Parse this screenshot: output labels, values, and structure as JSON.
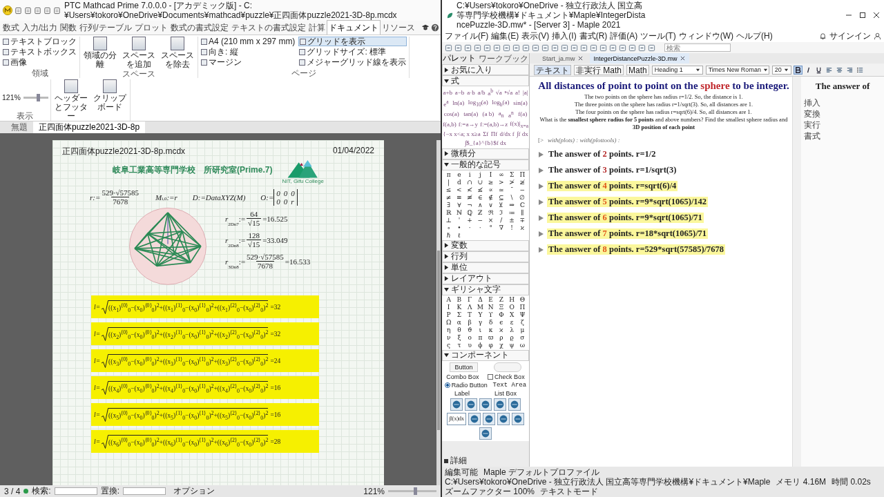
{
  "mathcad": {
    "title": "PTC Mathcad Prime 7.0.0.0 - [アカデミック版] - C:¥Users¥tokoro¥OneDrive¥Documents¥mathcad¥puzzle¥正四面体puzzle2021-3D-8p.mcdx",
    "tabs": [
      {
        "label": "数式",
        "selected": false
      },
      {
        "label": "入力/出力",
        "selected": false
      },
      {
        "label": "関数",
        "selected": false
      },
      {
        "label": "行列/テーブル",
        "selected": false
      },
      {
        "label": "プロット",
        "selected": false
      },
      {
        "label": "数式の書式設定",
        "selected": false
      },
      {
        "label": "テキストの書式設定",
        "selected": false
      },
      {
        "label": "計算",
        "selected": false
      },
      {
        "label": "ドキュメント",
        "selected": true
      },
      {
        "label": "リソース",
        "selected": false
      }
    ],
    "ribbon": [
      {
        "label": "領域",
        "columns": [
          [
            {
              "kind": "small",
              "label": "テキストブロック"
            },
            {
              "kind": "small",
              "label": "テキストボックス"
            },
            {
              "kind": "small",
              "label": "画像"
            }
          ]
        ]
      },
      {
        "label": "スペース",
        "columns": [
          [
            {
              "kind": "large",
              "label": "領域の分離"
            }
          ],
          [
            {
              "kind": "large",
              "label": "スペースを追加"
            }
          ],
          [
            {
              "kind": "large",
              "label": "スペースを除去"
            }
          ]
        ]
      },
      {
        "label": "ページ",
        "columns": [
          [
            {
              "kind": "small",
              "label": "A4 (210 mm x 297 mm)"
            },
            {
              "kind": "small",
              "label": "向き: 縦"
            },
            {
              "kind": "small",
              "label": "マージン"
            }
          ],
          [
            {
              "kind": "toggle",
              "label": "グリッドを表示",
              "selected": true
            },
            {
              "kind": "small",
              "label": "グリッドサイズ: 標準"
            },
            {
              "kind": "small",
              "label": "メジャーグリッド線を表示"
            }
          ]
        ]
      },
      {
        "label": "表示",
        "columns": [
          [
            {
              "kind": "zoom",
              "label": "121%",
              "level": 0.6
            }
          ]
        ]
      },
      {
        "columns": [
          [
            {
              "kind": "large",
              "label": "ヘッダーとフッター"
            }
          ],
          [
            {
              "kind": "large",
              "label": "クリップボード"
            }
          ]
        ]
      }
    ],
    "doc_tabs": [
      {
        "label": "無題",
        "selected": false
      },
      {
        "label": "正四面体puzzle2021-3D-8p",
        "selected": true
      }
    ],
    "page": {
      "file": "正四面体puzzle2021-3D-8p.mcdx",
      "date": "01/04/2022",
      "school": "岐阜工業高等専門学校　所研究室(Prime.7)",
      "logo_caption": "NIT, Gifu College",
      "def_r": {
        "lhs": "r:=",
        "num": "529·√57585",
        "den": "7678"
      },
      "def_m": {
        "name": "M",
        "sub": "i,0",
        "rhs": ":=r"
      },
      "def_d": "D:=DataXYZ(M)",
      "def_o": {
        "lhs": "O:=",
        "rows": [
          [
            "0",
            "0",
            "0"
          ],
          [
            "0",
            "0",
            "r"
          ]
        ]
      },
      "radii": [
        {
          "name": "r",
          "sub": "2Dn7",
          "assign": ":=",
          "num": "64",
          "den": "√15",
          "result": "=16.525"
        },
        {
          "name": "r",
          "sub": "2Dn8",
          "assign": ":=",
          "num": "128",
          "den": "√15",
          "result": "=33.049"
        },
        {
          "name": "r",
          "sub": "3Dn8",
          "assign": ":=",
          "num": "529·√57585",
          "den": "7678",
          "result": "=16.533"
        }
      ],
      "distances": [
        {
          "lhs": "l=",
          "expr": "((x$_{1}$)$^{⟨0⟩}$$_{0}$−(x$_{0}$)$^{⟨0⟩}$$_{0}$)$^{2}$+((x$_{1}$)$^{⟨1⟩}$$_{0}$−(x$_{0}$)$^{⟨1⟩}$$_{0}$)$^{2}$+((x$_{1}$)$^{⟨2⟩}$$_{0}$−(x$_{0}$)$^{⟨2⟩}$$_{0}$)$^{2}$",
          "result": "=32"
        },
        {
          "lhs": "l=",
          "expr": "((x$_{2}$)$^{⟨0⟩}$$_{0}$−(x$_{0}$)$^{⟨0⟩}$$_{0}$)$^{2}$+((x$_{2}$)$^{⟨1⟩}$$_{0}$−(x$_{0}$)$^{⟨1⟩}$$_{0}$)$^{2}$+((x$_{2}$)$^{⟨2⟩}$$_{0}$−(x$_{0}$)$^{⟨2⟩}$$_{0}$)$^{2}$",
          "result": "=32"
        },
        {
          "lhs": "l=",
          "expr": "((x$_{3}$)$^{⟨0⟩}$$_{0}$−(x$_{0}$)$^{⟨0⟩}$$_{0}$)$^{2}$+((x$_{3}$)$^{⟨1⟩}$$_{0}$−(x$_{0}$)$^{⟨1⟩}$$_{0}$)$^{2}$+((x$_{3}$)$^{⟨2⟩}$$_{0}$−(x$_{0}$)$^{⟨2⟩}$$_{0}$)$^{2}$",
          "result": "=24"
        },
        {
          "lhs": "l=",
          "expr": "((x$_{4}$)$^{⟨0⟩}$$_{0}$−(x$_{0}$)$^{⟨0⟩}$$_{0}$)$^{2}$+((x$_{4}$)$^{⟨1⟩}$$_{0}$−(x$_{0}$)$^{⟨1⟩}$$_{0}$)$^{2}$+((x$_{4}$)$^{⟨2⟩}$$_{0}$−(x$_{0}$)$^{⟨2⟩}$$_{0}$)$^{2}$",
          "result": "=16"
        },
        {
          "lhs": "l=",
          "expr": "((x$_{5}$)$^{⟨0⟩}$$_{0}$−(x$_{0}$)$^{⟨0⟩}$$_{0}$)$^{2}$+((x$_{5}$)$^{⟨1⟩}$$_{0}$−(x$_{0}$)$^{⟨1⟩}$$_{0}$)$^{2}$+((x$_{5}$)$^{⟨2⟩}$$_{0}$−(x$_{0}$)$^{⟨2⟩}$$_{0}$)$^{2}$",
          "result": "=16"
        },
        {
          "lhs": "l=",
          "expr": "((x$_{6}$)$^{⟨0⟩}$$_{0}$−(x$_{0}$)$^{⟨0⟩}$$_{0}$)$^{2}$+((x$_{6}$)$^{⟨1⟩}$$_{0}$−(x$_{0}$)$^{⟨1⟩}$$_{0}$)$^{2}$+((x$_{6}$)$^{⟨2⟩}$$_{0}$−(x$_{0}$)$^{⟨2⟩}$$_{0}$)$^{2}$",
          "result": "=28"
        }
      ]
    },
    "status": {
      "page": "3 / 4",
      "find": "検索:",
      "replace": "置換:",
      "options": "オプション",
      "zoom": "121%",
      "zoom_slider": {
        "level": 0.55
      }
    }
  },
  "maple": {
    "title": "C:¥Users¥tokoro¥OneDrive - 独立行政法人 国立高等専門学校機構¥ドキュメント¥Maple¥IntegerDistancePuzzle-3D.mw* - [Server 3] - Maple 2021",
    "menu": [
      "ファイル(F)",
      "編集(E)",
      "表示(V)",
      "挿入(I)",
      "書式(R)",
      "評価(A)",
      "ツール(T)",
      "ウィンドウ(W)",
      "ヘルプ(H)"
    ],
    "signin": "サインイン",
    "search_placeholder": "検索",
    "panel_tabs": [
      {
        "label": "パレット",
        "selected": true
      },
      {
        "label": "ワークブック",
        "selected": false
      }
    ],
    "palettes": [
      {
        "title": "お気に入り",
        "expanded": false
      },
      {
        "title": "式",
        "expanded": true,
        "kind": "expression",
        "items": [
          "a+b",
          "a−b",
          "a·b",
          "a/b",
          "a$^{b}$",
          "√a",
          "ⁿ√a",
          "a!",
          "|a|",
          "e$^{a}$",
          "ln(a)",
          "log$_{10}$(a)",
          "log$_{b}$(a)",
          "sin(a)",
          "cos(a)",
          "tan(a)",
          "(a b)",
          "a$_{n}$",
          "a$^{n}$",
          "f(a)",
          "f(a,b)",
          "f:=a→y",
          "f:=(a,b)→z",
          "f(x)|$_{x=a}$",
          "{−x x<a; x x≥a",
          "Σf",
          "Πf",
          "d/dx f",
          "∫f dx",
          "∫$_{a}^{b}$f dx"
        ]
      },
      {
        "title": "微積分",
        "expanded": false
      },
      {
        "title": "一般的な記号",
        "expanded": true,
        "kind": "symbols",
        "items": [
          "π",
          "e",
          "i",
          "j",
          "I",
          "∞",
          "Σ",
          "Π",
          "|",
          "d",
          "∩",
          "∪",
          "≥",
          ">",
          "≯",
          "≱",
          "≤",
          "<",
          "≮",
          "≰",
          "∝",
          "≃",
          "¯",
          "−",
          "≠",
          "≡",
          "≢",
          "∈",
          "∉",
          "⊆",
          "\\",
          "∅",
          "∃",
          "∀",
          "¬",
          "∧",
          "∨",
          "⊻",
          "⇒",
          "ℂ",
          "ℝ",
          "ℕ",
          "ℚ",
          "ℤ",
          "ℜ",
          "ℑ",
          "≔",
          "∥",
          "⊥",
          "'",
          "+",
          "−",
          "×",
          "/",
          "±",
          "∓",
          "∘",
          "•",
          "·",
          "⋅",
          "°",
          "∇",
          "!",
          "ϰ",
          "ℏ",
          "ℓ"
        ]
      },
      {
        "title": "変数",
        "expanded": false
      },
      {
        "title": "行列",
        "expanded": false
      },
      {
        "title": "単位",
        "expanded": false
      },
      {
        "title": "レイアウト",
        "expanded": false
      },
      {
        "title": "ギリシャ文字",
        "expanded": true,
        "kind": "symbols",
        "items": [
          "Α",
          "Β",
          "Γ",
          "Δ",
          "Ε",
          "Ζ",
          "Η",
          "Θ",
          "Ι",
          "Κ",
          "Λ",
          "Μ",
          "Ν",
          "Ξ",
          "Ο",
          "Π",
          "Ρ",
          "Σ",
          "Τ",
          "Υ",
          "ϒ",
          "Φ",
          "Χ",
          "Ψ",
          "Ω",
          "α",
          "β",
          "γ",
          "δ",
          "ϵ",
          "ε",
          "ζ",
          "η",
          "θ",
          "ϑ",
          "ι",
          "κ",
          "ϰ",
          "λ",
          "μ",
          "ν",
          "ξ",
          "ο",
          "π",
          "ϖ",
          "ρ",
          "ϱ",
          "σ",
          "ς",
          "τ",
          "υ",
          "ϕ",
          "φ",
          "χ",
          "ψ",
          "ω"
        ]
      },
      {
        "title": "コンポーネント",
        "expanded": true,
        "kind": "components",
        "button": "Button",
        "combo": "Combo Box",
        "check": "Check Box",
        "radio": "Radio Button",
        "radio_selected": true,
        "text_area": "Text Area",
        "label": "Label",
        "list": "List Box",
        "math_tile": "∫f(x)dx"
      }
    ],
    "details": "詳細",
    "doc_tabs": [
      {
        "label": "Start_ja.mw",
        "selected": false
      },
      {
        "label": "IntegerDistancePuzzle-3D.mw",
        "selected": true
      }
    ],
    "format_bar": {
      "modes": [
        {
          "label": "テキスト",
          "selected": true
        },
        {
          "label": "非実行 Math",
          "selected": false
        },
        {
          "label": "Math",
          "selected": false
        }
      ],
      "style": "Heading 1",
      "font": "Times New Roman",
      "size": "20",
      "bold": true,
      "italic": false,
      "underline": false
    },
    "document": {
      "title_parts": [
        {
          "text": "All distances of point to point on the",
          "accent": false
        },
        {
          "text": "sphere",
          "accent": true
        },
        {
          "text": "to be integer.",
          "accent": false
        }
      ],
      "paragraphs": [
        "The two points on the sphere has radius r=1/2. So, the distance is 1.",
        "The three points on the sphere has radius r=1/sqrt(3). So, all distances are 1.",
        "The four points on the sphere has radius r=sqrt(6)/4. So, all distances are 1.",
        "What is the **smallest sphere radius for 5 points** and above numbers?  Find the smallest sphere radius and **3D position of each point**"
      ],
      "prompt": "[>",
      "command": "with(plots) : with(plottools) :",
      "answers": [
        {
          "prefix": "The answer of",
          "count": "2",
          "suffix": "points. r=1/2",
          "highlighted": false
        },
        {
          "prefix": "The answer of",
          "count": "3",
          "suffix": "points. r=1/sqrt(3)",
          "highlighted": false
        },
        {
          "prefix": "The answer of",
          "count": "4",
          "suffix": "points. r=sqrt(6)/4",
          "highlighted": true
        },
        {
          "prefix": "The answer of",
          "count": "5",
          "suffix": "points. r=9*sqrt(1065)/142",
          "highlighted": true
        },
        {
          "prefix": "The answer of",
          "count": "6",
          "suffix": "points. r=9*sqrt(1065)/71",
          "highlighted": true
        },
        {
          "prefix": "The answer of",
          "count": "7",
          "suffix": "points. r=18*sqrt(1065)/71",
          "highlighted": true
        },
        {
          "prefix": "The answer of",
          "count": "8",
          "suffix": "points. r=529*sqrt(57585)/7678",
          "highlighted": true
        }
      ]
    },
    "side_panel": {
      "heading": "The answer of",
      "items": [
        "挿入",
        "変換",
        "実行",
        "書式"
      ]
    },
    "status": [
      "編集可能",
      "Maple デフォルトプロファイル",
      "C:¥Users¥tokoro¥OneDrive - 独立行政法人 国立高等専門学校機構¥ドキュメント¥Maple",
      "メモリ 4.16M",
      "時間 0.02s",
      "ズームファクター 100%",
      "テキストモード"
    ]
  }
}
